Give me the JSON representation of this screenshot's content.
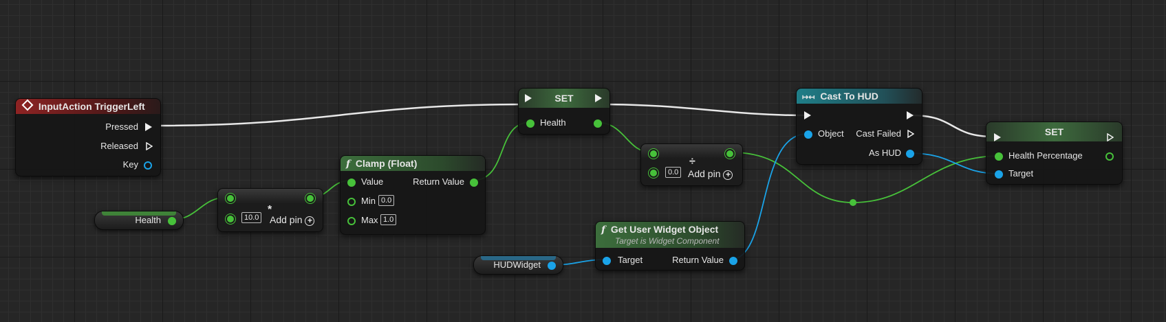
{
  "nodes": {
    "input_action": {
      "title": "InputAction TriggerLeft",
      "pins": {
        "pressed": "Pressed",
        "released": "Released",
        "key": "Key"
      }
    },
    "health_var": {
      "label": "Health"
    },
    "multiply": {
      "value": "10.0",
      "operator": "*",
      "add_pin": "Add pin"
    },
    "clamp": {
      "title": "Clamp (Float)",
      "value": "Value",
      "min": "Min",
      "min_value": "0.0",
      "max": "Max",
      "max_value": "1.0",
      "return_value": "Return Value"
    },
    "set_health": {
      "title": "SET",
      "pin": "Health"
    },
    "divide": {
      "value": "0.0",
      "operator": "÷",
      "add_pin": "Add pin"
    },
    "hud_widget_var": {
      "label": "HUDWidget"
    },
    "get_user_widget": {
      "title": "Get User Widget Object",
      "subtitle": "Target is Widget Component",
      "target": "Target",
      "return_value": "Return Value"
    },
    "cast_to_hud": {
      "title": "Cast To HUD",
      "object": "Object",
      "cast_failed": "Cast Failed",
      "as_hud": "As HUD"
    },
    "set_health_pct": {
      "title": "SET",
      "health_percentage": "Health Percentage",
      "target": "Target"
    }
  },
  "colors": {
    "exec": "#f0f0f0",
    "float_pin": "#47c13a",
    "object_pin": "#1aa3e8",
    "event_header": "#8e2323",
    "function_header": "#3c6e3c",
    "cast_header": "#1f7e88"
  },
  "icons": {
    "event": "diamond-event-icon",
    "function": "function-f-icon",
    "cast": "cast-arrows-icon",
    "add_pin": "plus-circle-icon"
  }
}
